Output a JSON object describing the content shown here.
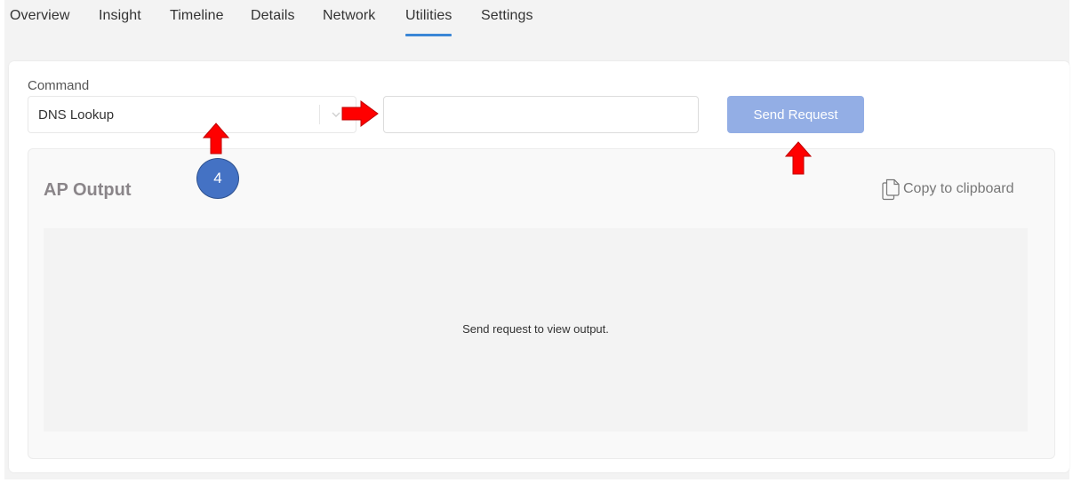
{
  "tabs": [
    {
      "label": "Overview"
    },
    {
      "label": "Insight"
    },
    {
      "label": "Timeline"
    },
    {
      "label": "Details"
    },
    {
      "label": "Network"
    },
    {
      "label": "Utilities",
      "active": true
    },
    {
      "label": "Settings"
    }
  ],
  "command": {
    "label": "Command",
    "selected": "DNS Lookup",
    "input_value": "",
    "send_label": "Send Request"
  },
  "output": {
    "title": "AP Output",
    "copy_label": "Copy to clipboard",
    "empty_message": "Send request to view output."
  },
  "annotation": {
    "badge_number": "4"
  },
  "colors": {
    "active_tab_underline": "#3a86d6",
    "send_button": "#93aee5",
    "arrow": "#ff0000",
    "badge": "#4472c4"
  }
}
